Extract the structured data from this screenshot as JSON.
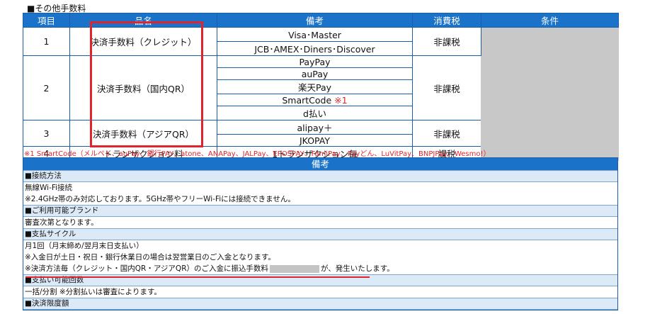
{
  "section_title": "■その他手数料",
  "table": {
    "headers": [
      "項目",
      "品名",
      "備考",
      "消費税",
      "条件"
    ],
    "rows": [
      {
        "no": "1",
        "name": "決済手数料（クレジット）",
        "notes": [
          "Visa･Master",
          "JCB･AMEX･Diners･Discover"
        ],
        "tax": "非課税"
      },
      {
        "no": "2",
        "name": "決済手数料（国内QR）",
        "notes": [
          "PayPay",
          "auPay",
          "楽天Pay",
          "SmartCode",
          "d払い"
        ],
        "note_mark": "※1",
        "tax": "非課税"
      },
      {
        "no": "3",
        "name": "決済手数料（アジアQR）",
        "notes": [
          "alipay＋",
          "JKOPAY"
        ],
        "tax": "非課税"
      },
      {
        "no": "4",
        "name": "トランザクション料",
        "notes": [
          "1トランザクション毎"
        ],
        "tax": "課税"
      }
    ]
  },
  "footnote": "※1 SmartCode（メルペイ、auPay、銀行PAY、atone、ANAPay、JALPay、EPOSPAY、FamiPay、Payどん、LuVitPay、BNPJPay、Wesmo!）",
  "remarks": {
    "header": "備考",
    "sections": [
      {
        "title": "■接続方法",
        "lines": [
          "無線Wi-Fi接続",
          "※2.4GHz帯のみ対応しております。5GHz帯やフリーWi-Fiには接続できません。"
        ]
      },
      {
        "title": "■ご利用可能ブランド",
        "lines": [
          "審査次第となります。"
        ]
      },
      {
        "title": "■支払サイクル",
        "lines": [
          "月1回（月末締め/翌月末日支払い）",
          "※入金日が土日・祝日・銀行休業日の場合は翌営業日のご入金となります。"
        ],
        "fee_line_prefix": "※決済方法毎（クレジット・国内QR・アジアQR）のご入金に振込手数料",
        "fee_line_suffix": "が、発生いたします。"
      },
      {
        "title": "■支払い可能回数",
        "lines": [
          "一括/分割 ※分割払いは審査によります。"
        ]
      },
      {
        "title": "■決済限度額",
        "lines": []
      }
    ]
  },
  "colors": {
    "header_blue": "#1a73c9",
    "section_bg": "#dce9f7",
    "highlight_red": "#e0242e",
    "redacted_gray": "#c8c8c8"
  }
}
